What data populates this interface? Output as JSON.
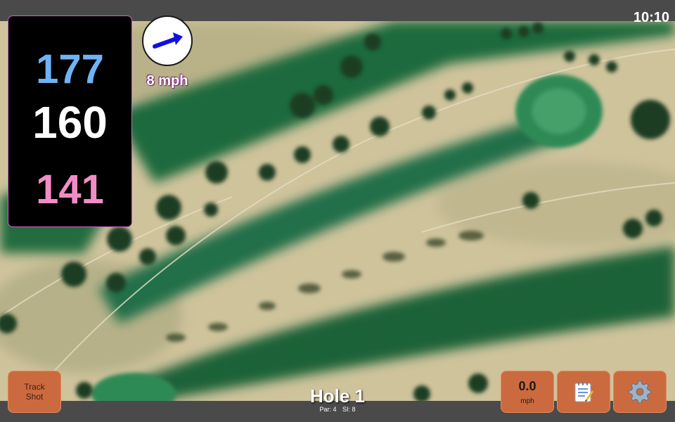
{
  "status_bar": {
    "time": "10:10"
  },
  "yardages": {
    "back": "177",
    "middle": "160",
    "front": "141",
    "colors": {
      "back": "#6eb3f5",
      "middle": "#ffffff",
      "front": "#f28cc6"
    }
  },
  "wind": {
    "speed": "8 mph",
    "direction_icon": "arrow-right-icon",
    "arrow_color": "#1010e0"
  },
  "hole": {
    "title": "Hole 1",
    "par": "Par: 4",
    "stroke_index": "SI: 8"
  },
  "buttons": {
    "track_shot": "Track Shot",
    "speed_value": "0.0",
    "speed_unit": "mph",
    "notes_icon": "notepad-icon",
    "settings_icon": "gear-icon"
  },
  "accent_colors": {
    "button": "#cc6a3f",
    "panel_border": "#cc66cc"
  }
}
